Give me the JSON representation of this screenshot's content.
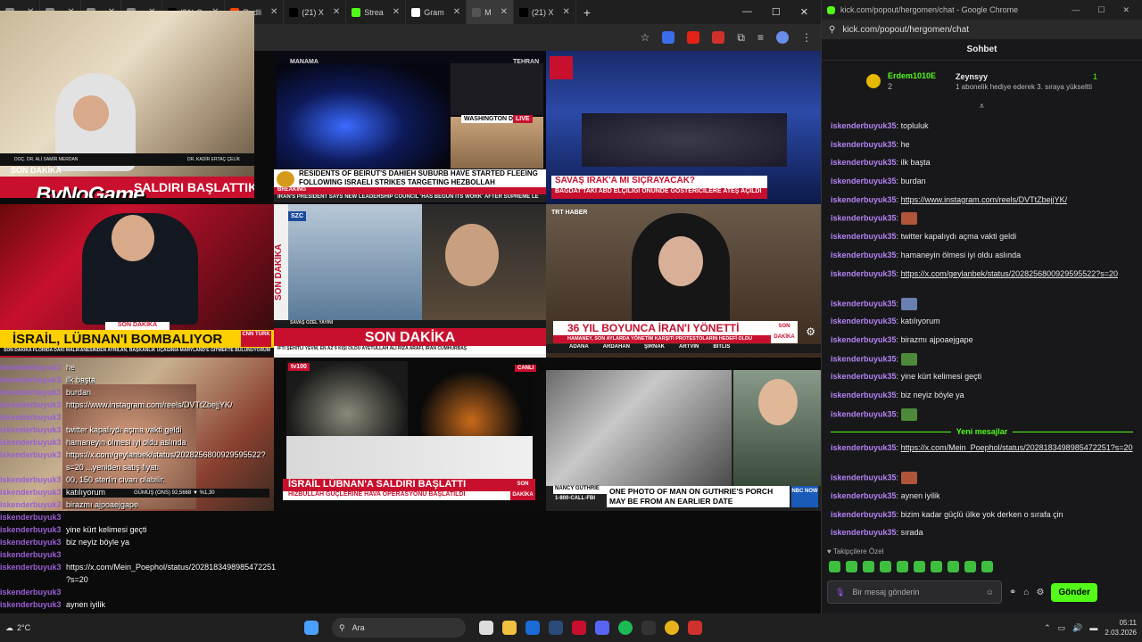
{
  "browser": {
    "tabs": [
      {
        "label": "",
        "color": "#888"
      },
      {
        "label": "",
        "color": "#888"
      },
      {
        "label": "",
        "color": "#888"
      },
      {
        "label": "",
        "color": "#888"
      },
      {
        "label": "(21) G",
        "color": "#000000"
      },
      {
        "label": "Redli",
        "color": "#ff4500"
      },
      {
        "label": "(21) X",
        "color": "#000000"
      },
      {
        "label": "Strea",
        "color": "#53fc18"
      },
      {
        "label": "Gram",
        "color": "#ffffff"
      },
      {
        "label": "M",
        "color": "#555555"
      },
      {
        "label": "(21) X",
        "color": "#000000"
      }
    ],
    "new_tab": "+",
    "window_controls": [
      "—",
      "☐",
      "✕"
    ]
  },
  "streamer": {
    "brand": "ByNoGame",
    "left_name": "DOÇ. DR. ALİ SAMİR MERDAN",
    "right_name": "DR. KADİR ERTAÇ ÇELİK",
    "caption": "SON DAKİKA",
    "headline": "SALDIRI BAŞLATTIK"
  },
  "tiles": {
    "aljazeera": {
      "loc1": "MANAMA",
      "loc2": "TEHRAN",
      "loc3": "WASHINGTON DC",
      "live": "LIVE",
      "headline": "RESIDENTS OF BEIRUT'S DAHIEH SUBURB HAVE STARTED FLEEING FOLLOWING ISRAELI STRIKES TARGETING HEZBOLLAH",
      "breaking": "BREAKING",
      "crawl": "IRAN'S PRESIDENT SAYS NEW LEADERSHIP COUNCIL 'HAS BEGUN ITS WORK' AFTER SUPREME LE"
    },
    "halk": {
      "headline": "SAVAŞ IRAK'A MI SIÇRAYACAK?",
      "sub": "BAĞDAT'TAKİ ABD ELÇİLİĞİ ÖNÜNDE GÖSTERİCİLERE ATEŞ AÇILDI"
    },
    "cnn": {
      "caption": "SON DAKİKA",
      "headline": "İSRAİL, LÜBNAN'I BOMBALIYOR",
      "logo": "CNN TÜRK",
      "crawl": "SON DAKİKA  FLORIDA DAKİ MALİKANESİNDEN AYRILAN, BAŞKANLIK UÇAĞINIA MARYLAND'E GİTMEKTE BULUNUYORUM"
    },
    "szc": {
      "logo": "SZC",
      "side": "SON DAKİKA",
      "banner": "SAVAŞ ÖZEL YAYINI",
      "headline": "SON DAKİKA",
      "crawl": "İFTİ ŞEHİTLİ YEVM, EN AZ 9 KİŞİ ÖLDÜ  AYETULLAH ALİ RIZA ARAFİ, İRAN CUMHURBAŞ"
    },
    "trt": {
      "logo": "TRT HABER",
      "headline": "36 YIL BOYUNCA İRAN'I YÖNETTİ",
      "sub": "HAMANEY, SON AYLARDA YÖNETİM KARŞITI PROTESTOLARIN HEDEFİ OLDU",
      "corner": "SON DAKİKA",
      "cities": [
        "ADANA",
        "ARDAHAN",
        "ŞIRNAK",
        "ARTVİN",
        "BİTLİS"
      ]
    },
    "tv100": {
      "logo": "tv100",
      "live": "CANLI",
      "headline": "İSRAİL LÜBNAN'A SALDIRI BAŞLATTI",
      "sub": "HİZBULLAH GÜÇLERİNE HAVA OPERASYONU BAŞLATILDI",
      "corner": "SON DAKİKA"
    },
    "nbc": {
      "name": "NANCY GUTHRIE",
      "phone": "1-800-CALL-FBI",
      "headline": "ONE PHOTO OF MAN ON GUTHRIE'S PORCH MAY BE FROM AN EARLIER DATE",
      "logo": "NBC NOW"
    },
    "market": "GÜMÜŞ (ONS)  92,5668 ▼ %1,30"
  },
  "overlay_chat": [
    {
      "user": "iskenderbuyuk35",
      "msg": "he"
    },
    {
      "user": "iskenderbuyuk35",
      "msg": "ilk başta"
    },
    {
      "user": "iskenderbuyuk35",
      "msg": "burdan"
    },
    {
      "user": "iskenderbuyuk35",
      "msg": "https://www.instagram.com/reels/DVTtZbejjYK/"
    },
    {
      "user": "iskenderbuyuk35",
      "msg": ""
    },
    {
      "user": "iskenderbuyuk35",
      "msg": "twitter kapalıydı açma vakti geldi"
    },
    {
      "user": "iskenderbuyuk35",
      "msg": "hamaneyin ölmesi iyi oldu aslında"
    },
    {
      "user": "iskenderbuyuk35",
      "msg": "https://x.com/geylanbek/status/2028256800929595522?"
    },
    {
      "user": "",
      "msg": "s=20  ...yeniden satış fiyatı"
    },
    {
      "user": "iskenderbuyuk35",
      "msg": "00, 150 sterlin civarı olabilir."
    },
    {
      "user": "iskenderbuyuk35",
      "msg": "katılıyorum"
    },
    {
      "user": "iskenderbuyuk35",
      "msg": "birazmı ajpoaejgape"
    },
    {
      "user": "iskenderbuyuk35",
      "msg": ""
    },
    {
      "user": "iskenderbuyuk35",
      "msg": "yine kürt kelimesi geçti"
    },
    {
      "user": "iskenderbuyuk35",
      "msg": "biz neyiz böyle ya"
    },
    {
      "user": "iskenderbuyuk35",
      "msg": ""
    },
    {
      "user": "iskenderbuyuk35",
      "msg": "https://x.com/Mein_Poephol/status/2028183498985472251"
    },
    {
      "user": "",
      "msg": "?s=20"
    },
    {
      "user": "iskenderbuyuk35",
      "msg": ""
    },
    {
      "user": "iskenderbuyuk35",
      "msg": "aynen iyilik"
    },
    {
      "user": "iskenderbuyuk35",
      "msg": "bizim kadar güçlü ülke yok derken o sırafa çin"
    },
    {
      "user": "iskenderbuyuk35",
      "msg": "sırada"
    }
  ],
  "kick": {
    "window_title": "kick.com/popout/hergomen/chat - Google Chrome",
    "url": "kick.com/popout/hergomen/chat",
    "header": "Sohbet",
    "gift": {
      "rank": "1",
      "gifter": "Erdem1010E",
      "gifter_count": "2",
      "recipient": "Zeynsyy",
      "recipient_count": "1",
      "text": "1 abonelik hediye ederek 3. sıraya yükseltti"
    },
    "messages": [
      {
        "user": "iskenderbuyuk35",
        "text": "topluluk",
        "link": false
      },
      {
        "user": "iskenderbuyuk35",
        "text": "he",
        "link": false
      },
      {
        "user": "iskenderbuyuk35",
        "text": "ilk başta",
        "link": false
      },
      {
        "user": "iskenderbuyuk35",
        "text": "burdan",
        "link": false
      },
      {
        "user": "iskenderbuyuk35",
        "text": "https://www.instagram.com/reels/DVTtZbejjYK/",
        "link": true
      },
      {
        "user": "iskenderbuyuk35",
        "text": "",
        "emote": "#b0553a"
      },
      {
        "user": "iskenderbuyuk35",
        "text": "twitter kapalıydı açma vakti geldi",
        "link": false
      },
      {
        "user": "iskenderbuyuk35",
        "text": "hamaneyin ölmesi iyi oldu aslında",
        "link": false
      },
      {
        "user": "iskenderbuyuk35",
        "text": "https://x.com/geylanbek/status/2028256800929595522?s=20",
        "link": true,
        "double": true
      },
      {
        "user": "iskenderbuyuk35",
        "text": "",
        "emote": "#6a7fb0"
      },
      {
        "user": "iskenderbuyuk35",
        "text": "katılıyorum",
        "link": false
      },
      {
        "user": "iskenderbuyuk35",
        "text": "birazmı ajpoaejgape",
        "link": false
      },
      {
        "user": "iskenderbuyuk35",
        "text": "",
        "emote": "#4c8a3a"
      },
      {
        "user": "iskenderbuyuk35",
        "text": "yine kürt kelimesi geçti",
        "link": false
      },
      {
        "user": "iskenderbuyuk35",
        "text": "biz neyiz böyle ya",
        "link": false
      },
      {
        "user": "iskenderbuyuk35",
        "text": "",
        "emote": "#4c8a3a"
      }
    ],
    "new_messages_label": "Yeni mesajlar",
    "new_messages": [
      {
        "user": "iskenderbuyuk35",
        "text": "https://x.com/Mein_Poephol/status/2028183498985472251?s=20",
        "link": true,
        "double": true
      },
      {
        "user": "iskenderbuyuk35",
        "text": "",
        "emote": "#b0553a"
      },
      {
        "user": "iskenderbuyuk35",
        "text": "aynen iyilik",
        "link": false
      },
      {
        "user": "iskenderbuyuk35",
        "text": "bizim kadar güçlü ülke yok derken o sırafa çin",
        "link": false
      },
      {
        "user": "iskenderbuyuk35",
        "text": "sırada",
        "link": false
      }
    ],
    "followers_only": "Takipçilere Özel",
    "input_placeholder": "Bir mesaj gönderin",
    "send_label": "Gönder",
    "accent": "#53fc18"
  },
  "taskbar": {
    "search_label": "Ara",
    "weather": "2°C",
    "time": "05:11",
    "date": "2.03.2026"
  }
}
